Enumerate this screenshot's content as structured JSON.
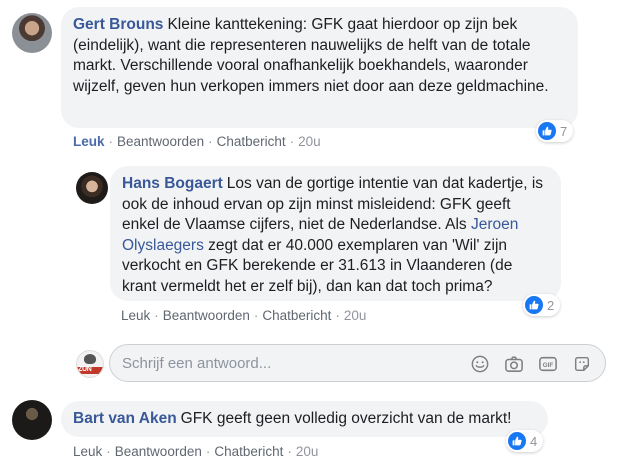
{
  "colors": {
    "link": "#385898",
    "bubble": "#f2f3f5",
    "like_blue": "#1877f2",
    "meta": "#90949c"
  },
  "comments": [
    {
      "author": "Gert Brouns",
      "text": "Kleine kanttekening: GFK gaat hierdoor op zijn bek (eindelijk), want die representeren nauwelijks de helft van de totale markt. Verschillende vooral onafhankelijk boekhandels, waaronder wijzelf, geven hun verkopen immers niet door aan deze geldmachine.",
      "actions": {
        "like": "Leuk",
        "reply": "Beantwoorden",
        "message": "Chatbericht",
        "time": "20u"
      },
      "reaction_count": "7"
    },
    {
      "author": "Hans Bogaert",
      "text_before": "Los van de gortige intentie van dat kadertje, is ook de inhoud ervan op zijn minst misleidend: GFK geeft enkel de Vlaamse cijfers, niet de Nederlandse. Als",
      "mention": "Jeroen Olyslaegers",
      "text_after": "zegt dat er 40.000 exemplaren van 'Wil' zijn verkocht en GFK berekende er 31.613 in Vlaanderen (de krant vermeldt het er zelf bij), dan kan dat toch prima?",
      "actions": {
        "like": "Leuk",
        "reply": "Beantwoorden",
        "message": "Chatbericht",
        "time": "20u"
      },
      "reaction_count": "2"
    },
    {
      "author": "Bart van Aken",
      "text": "GFK geeft geen volledig overzicht van de markt!",
      "actions": {
        "like": "Leuk",
        "reply": "Beantwoorden",
        "message": "Chatbericht",
        "time": "20u"
      },
      "reaction_count": "4"
    }
  ],
  "reply_input": {
    "placeholder": "Schrijf een antwoord...",
    "value": "",
    "avatar_label": "ZUN",
    "tools": [
      "emoji-icon",
      "camera-icon",
      "gif-icon",
      "sticker-icon"
    ]
  },
  "icons": {
    "reaction": "like-thumb-icon"
  }
}
